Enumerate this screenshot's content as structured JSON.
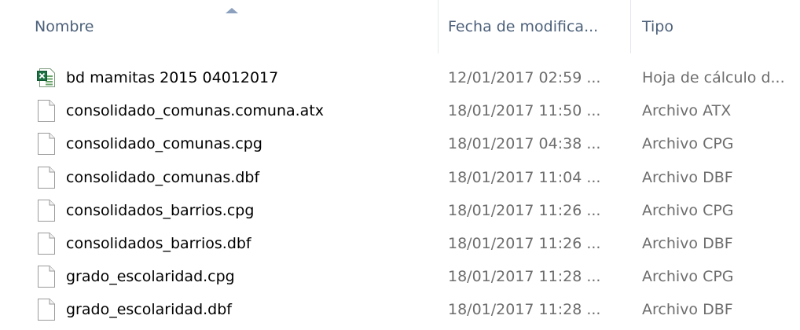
{
  "columns": {
    "name": "Nombre",
    "date": "Fecha de modifica...",
    "type": "Tipo"
  },
  "files": [
    {
      "name": "bd mamitas 2015 04012017",
      "date": "12/01/2017 02:59 ...",
      "type": "Hoja de cálculo d...",
      "icon": "excel-file-icon"
    },
    {
      "name": "consolidado_comunas.comuna.atx",
      "date": "18/01/2017 11:50 ...",
      "type": "Archivo ATX",
      "icon": "generic-file-icon"
    },
    {
      "name": "consolidado_comunas.cpg",
      "date": "18/01/2017 04:38 ...",
      "type": "Archivo CPG",
      "icon": "generic-file-icon"
    },
    {
      "name": "consolidado_comunas.dbf",
      "date": "18/01/2017 11:04 ...",
      "type": "Archivo DBF",
      "icon": "generic-file-icon"
    },
    {
      "name": "consolidados_barrios.cpg",
      "date": "18/01/2017 11:26 ...",
      "type": "Archivo CPG",
      "icon": "generic-file-icon"
    },
    {
      "name": "consolidados_barrios.dbf",
      "date": "18/01/2017 11:26 ...",
      "type": "Archivo DBF",
      "icon": "generic-file-icon"
    },
    {
      "name": "grado_escolaridad.cpg",
      "date": "18/01/2017 11:28 ...",
      "type": "Archivo CPG",
      "icon": "generic-file-icon"
    },
    {
      "name": "grado_escolaridad.dbf",
      "date": "18/01/2017 11:28 ...",
      "type": "Archivo DBF",
      "icon": "generic-file-icon"
    }
  ],
  "colors": {
    "header_text": "#4c607a",
    "secondary_text": "#6d6d6d",
    "excel_green": "#1e7145"
  }
}
